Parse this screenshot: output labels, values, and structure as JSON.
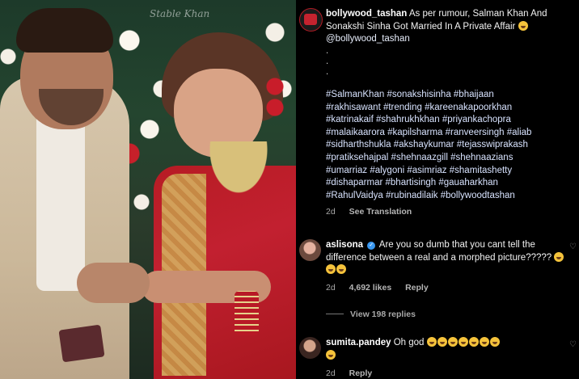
{
  "photo": {
    "watermark": "Stable Khan"
  },
  "post": {
    "username": "bollywood_tashan",
    "caption": "As per rumour, Salman Khan And Sonakshi Sinha Got Married In A Private Affair",
    "mention": "@bollywood_tashan",
    "dots": [
      ".",
      ".",
      "."
    ],
    "hashtag_lines": [
      "#SalmanKhan #sonakshisinha #bhaijaan",
      "#rakhisawant #trending #kareenakapoorkhan",
      "#katrinakaif #shahrukhkhan #priyankachopra",
      "#malaikaarora #kapilsharma #ranveersingh #aliab",
      "#sidharthshukla #akshaykumar #tejasswiprakash",
      "#pratiksehajpal #shehnaazgill #shehnaazians",
      "#umarriaz #alygoni #asimriaz #shamitashetty",
      "#dishaparmar #bhartisingh #gauaharkhan",
      "#RahulVaidya #rubinadilaik #bollywoodtashan"
    ],
    "age": "2d",
    "see_translation": "See Translation"
  },
  "comments": [
    {
      "username": "aslisona",
      "verified": true,
      "text": "Are you so dumb that you cant tell the difference between a real and a morphed picture?????",
      "age": "2d",
      "likes": "4,692 likes",
      "reply": "Reply",
      "view_replies": "View 198 replies"
    },
    {
      "username": "sumita.pandey",
      "text": "Oh god",
      "age": "2d",
      "reply": "Reply"
    }
  ]
}
